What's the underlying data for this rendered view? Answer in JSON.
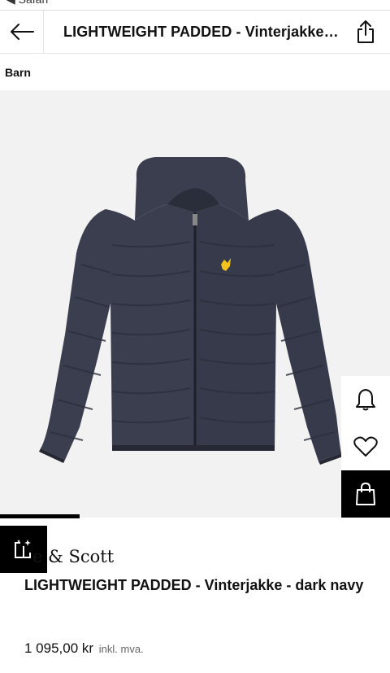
{
  "status_bar": {
    "back_app": "◀ Safari"
  },
  "header": {
    "title": "LIGHTWEIGHT PADDED - Vinterjakke - dark navy",
    "back_icon": "arrow-left-icon",
    "share_icon": "share-icon"
  },
  "breadcrumb": {
    "label": "Barn"
  },
  "product": {
    "image_alt": "jacket",
    "brand": "Lyle & Scott",
    "brand_visible": "e & Scott",
    "name": "LIGHTWEIGHT PADDED - Vinterjakke - dark navy",
    "price": "1 095,00 kr",
    "price_note": "inkl. mva.",
    "jacket_color": "#3a3e4f"
  },
  "side_actions": [
    "bell-icon",
    "heart-icon",
    "shopping-bag-icon"
  ],
  "compare_icon": "compare-icon"
}
